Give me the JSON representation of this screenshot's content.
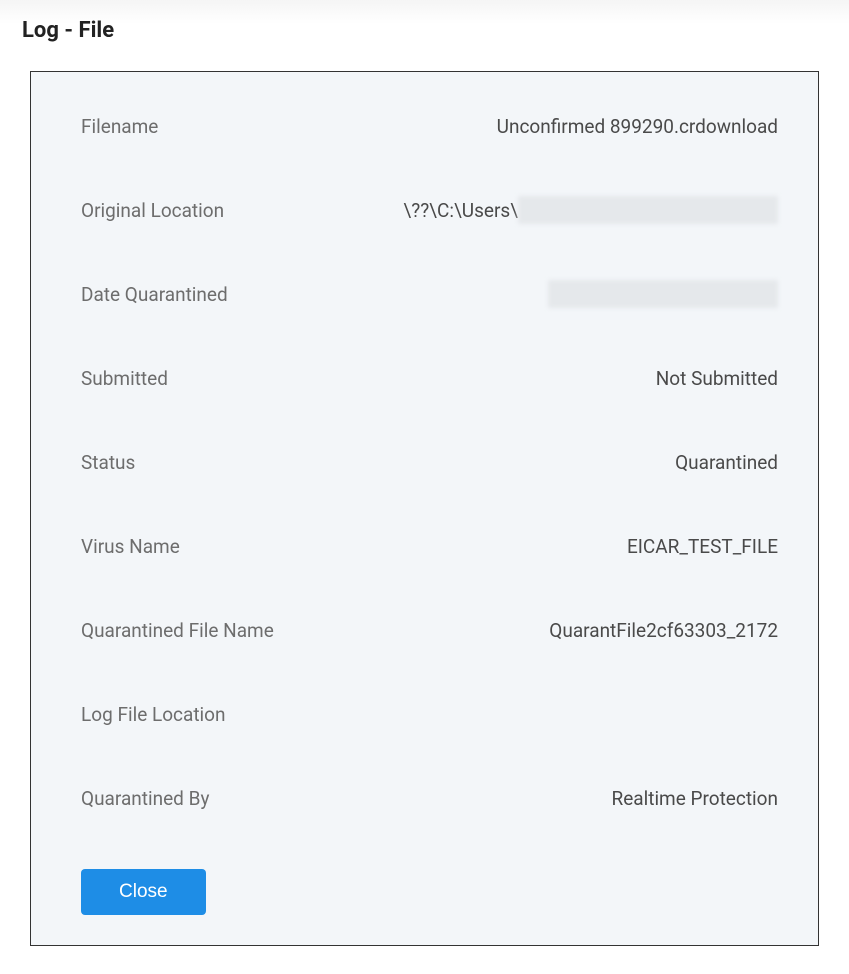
{
  "header": {
    "title": "Log - File"
  },
  "details": {
    "filename": {
      "label": "Filename",
      "value": "Unconfirmed 899290.crdownload"
    },
    "original_location": {
      "label": "Original Location",
      "value_prefix": "\\??\\C:\\Users\\"
    },
    "date_quarantined": {
      "label": "Date Quarantined"
    },
    "submitted": {
      "label": "Submitted",
      "value": "Not Submitted"
    },
    "status": {
      "label": "Status",
      "value": "Quarantined"
    },
    "virus_name": {
      "label": "Virus Name",
      "value": "EICAR_TEST_FILE"
    },
    "quarantined_file_name": {
      "label": "Quarantined File Name",
      "value": "QuarantFile2cf63303_2172"
    },
    "log_file_location": {
      "label": "Log File Location",
      "value": ""
    },
    "quarantined_by": {
      "label": "Quarantined By",
      "value": "Realtime Protection"
    }
  },
  "buttons": {
    "close": "Close"
  }
}
